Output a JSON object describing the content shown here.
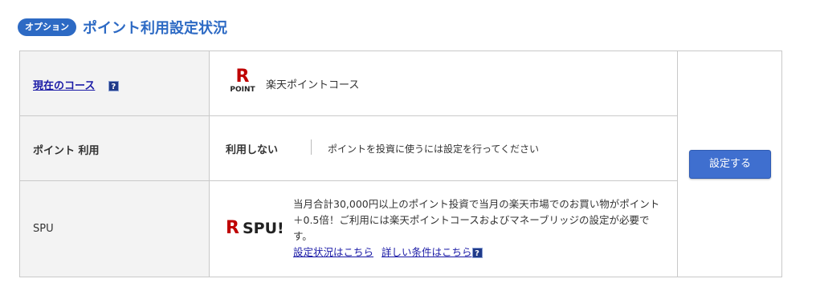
{
  "header": {
    "badge": "オプション",
    "title": "ポイント利用設定状況"
  },
  "rows": {
    "course": {
      "label": "現在のコース",
      "help_icon": "?",
      "logo": {
        "letter": "R",
        "sub": "POINT"
      },
      "value": "楽天ポイントコース"
    },
    "usage": {
      "label": "ポイント 利用",
      "value": "利用しない",
      "note": "ポイントを投資に使うには設定を行ってください"
    },
    "spu": {
      "label": "SPU",
      "logo": {
        "letter": "R",
        "text": "SPU!"
      },
      "description": "当月合計30,000円以上のポイント投資で当月の楽天市場でのお買い物がポイント＋0.5倍！ご利用には楽天ポイントコースおよびマネーブリッジの設定が必要です。",
      "link_status": "設定状況はこちら",
      "link_conditions": "詳しい条件はこちら",
      "help_icon": "?"
    }
  },
  "action": {
    "button_label": "設定する"
  },
  "colors": {
    "accent": "#2d6ac4",
    "rakuten_red": "#bf0000",
    "link": "#1a1aa6",
    "label_bg": "#f3f3f3"
  }
}
